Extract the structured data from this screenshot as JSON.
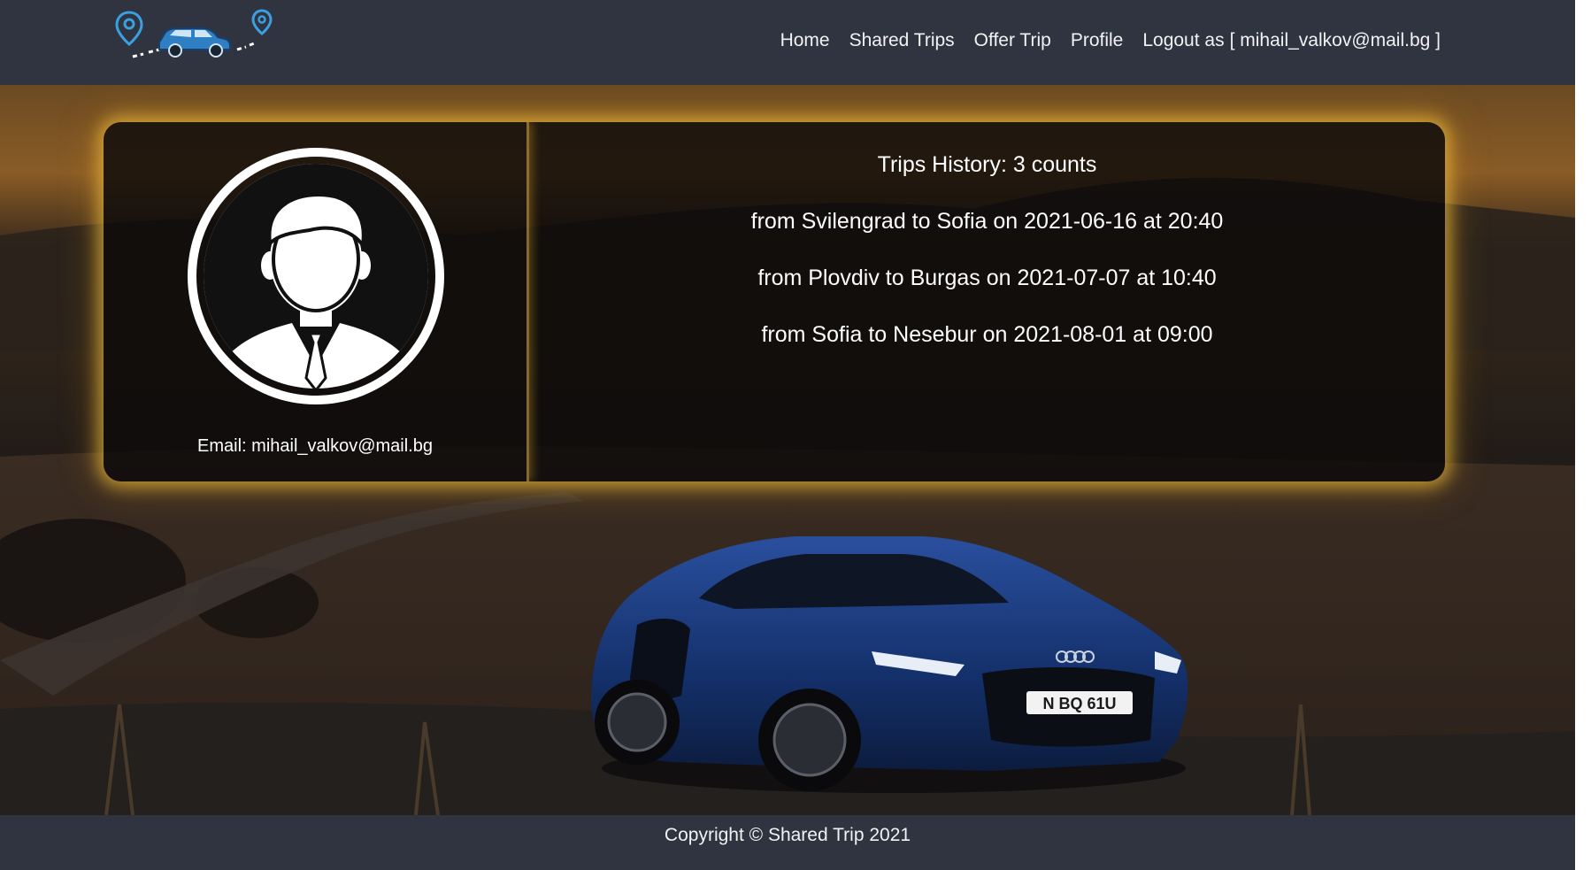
{
  "header": {
    "nav": {
      "home": "Home",
      "shared_trips": "Shared Trips",
      "offer_trip": "Offer Trip",
      "profile": "Profile",
      "logout_prefix": "Logout as",
      "logout_user": "[ mihail_valkov@mail.bg ]"
    }
  },
  "profile": {
    "email_label": "Email:",
    "email_value": "mihail_valkov@mail.bg",
    "history_label": "Trips History:",
    "history_count": "3 counts",
    "trips": [
      "from Svilengrad to Sofia on 2021-06-16 at 20:40",
      "from Plovdiv to Burgas on 2021-07-07 at 10:40",
      "from Sofia to Nesebur on 2021-08-01 at 09:00"
    ]
  },
  "hero": {
    "license_plate": "N BQ 61U"
  },
  "footer": {
    "copyright": "Copyright © Shared Trip 2021"
  },
  "colors": {
    "header_bg": "#2f3440",
    "card_glow": "#f0be3c",
    "car_blue": "#1a3f8a",
    "logo_blue": "#3aa0e0"
  }
}
